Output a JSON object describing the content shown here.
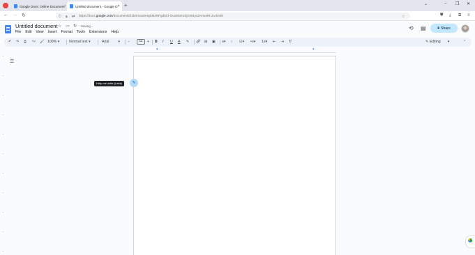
{
  "browser": {
    "tabs": [
      {
        "title": "Google Docs: Online Document",
        "active": false
      },
      {
        "title": "Untitled document - Google D",
        "active": true
      }
    ],
    "new_tab": "+",
    "tab_close": "×",
    "window_controls": {
      "minimize": "–",
      "restore": "❐",
      "close": "✕",
      "list": "⌄"
    },
    "url_prefix": "https://docs.",
    "url_domain": "google.com",
    "url_path": "/document/d/1bXmow0HqEM3NFgd6Ct-OuvMoKoXjGW4yu2Amu9R11v4/edit"
  },
  "docs": {
    "title": "Untitled document",
    "saving_status": "Saving...",
    "menu": [
      "File",
      "Edit",
      "View",
      "Insert",
      "Format",
      "Tools",
      "Extensions",
      "Help"
    ],
    "share_label": "Share",
    "toolbar": {
      "zoom": "100%",
      "style": "Normal text",
      "font": "Arial",
      "font_size": "11",
      "mode": "Editing"
    },
    "tooltip": "Help me write (Labs)"
  },
  "colors": {
    "accent": "#4285f4",
    "share_bg": "#c2e7ff",
    "toolbar_bg": "#edf2fa"
  }
}
